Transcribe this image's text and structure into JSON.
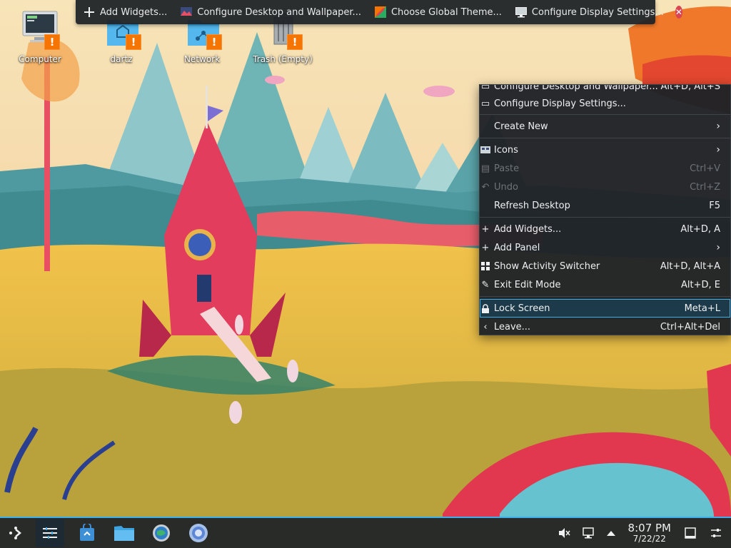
{
  "toolbar": {
    "items": [
      {
        "label": "Add Widgets...",
        "icon": "plus-icon"
      },
      {
        "label": "Configure Desktop and Wallpaper...",
        "icon": "desktop-wallpaper-icon"
      },
      {
        "label": "Choose Global Theme...",
        "icon": "global-theme-icon"
      },
      {
        "label": "Configure Display Settings...",
        "icon": "display-icon"
      }
    ],
    "close_icon": "close-icon"
  },
  "desktop": {
    "icons": [
      {
        "label": "Computer",
        "icon": "computer-icon"
      },
      {
        "label": "dartz",
        "icon": "home-folder-icon"
      },
      {
        "label": "Network",
        "icon": "network-folder-icon"
      },
      {
        "label": "Trash (Empty)",
        "icon": "trash-icon"
      }
    ],
    "badge": "!"
  },
  "menu": {
    "items": [
      {
        "label": "Configure Desktop and Wallpaper...",
        "shortcut": "Alt+D, Alt+S"
      },
      {
        "label": "Configure Display Settings..."
      },
      {
        "label": "Create New",
        "submenu": true
      },
      {
        "label": "Icons",
        "submenu": true
      },
      {
        "label": "Paste",
        "shortcut": "Ctrl+V",
        "disabled": true
      },
      {
        "label": "Undo",
        "shortcut": "Ctrl+Z",
        "disabled": true
      },
      {
        "label": "Refresh Desktop",
        "shortcut": "F5"
      },
      {
        "label": "Add Widgets...",
        "shortcut": "Alt+D, A"
      },
      {
        "label": "Add Panel",
        "submenu": true
      },
      {
        "label": "Show Activity Switcher",
        "shortcut": "Alt+D, Alt+A"
      },
      {
        "label": "Exit Edit Mode",
        "shortcut": "Alt+D, E"
      },
      {
        "label": "Lock Screen",
        "shortcut": "Meta+L",
        "highlighted": true
      },
      {
        "label": "Leave...",
        "shortcut": "Ctrl+Alt+Del"
      }
    ],
    "submenu_glyph": "›"
  },
  "taskbar": {
    "apps": [
      "app-launcher-icon",
      "pager-icon",
      "discover-icon",
      "dolphin-icon",
      "settings-icon",
      "browser-icon"
    ],
    "tray": {
      "time": "8:07 PM",
      "date": "7/22/22"
    }
  },
  "colors": {
    "accent": "#3daee9",
    "warning": "#f67400",
    "close": "#da4453",
    "menu_bg": "#202327"
  }
}
